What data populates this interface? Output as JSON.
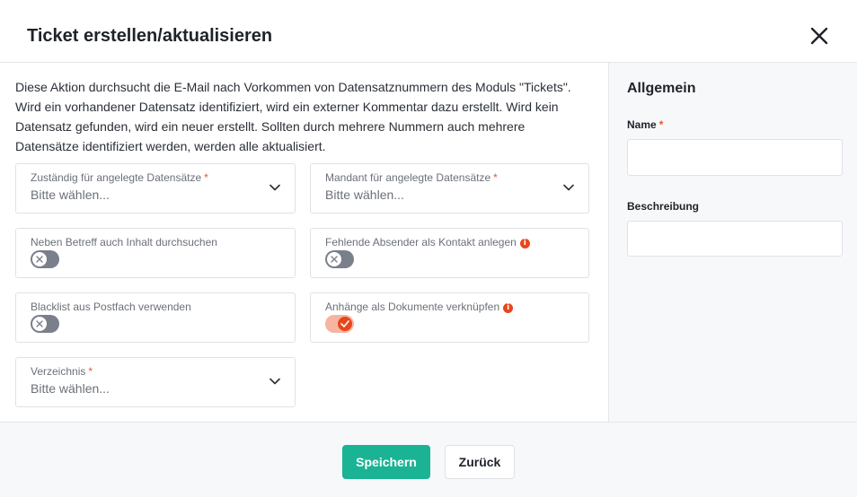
{
  "dialog": {
    "title": "Ticket erstellen/aktualisieren",
    "description": "Diese Aktion durchsucht die E-Mail nach Vorkommen von Datensatznummern des Moduls \"Tickets\". Wird ein vorhandener Datensatz identifiziert, wird ein externer Kommentar dazu erstellt. Wird kein Datensatz gefunden, wird ein neuer erstellt. Sollten durch mehrere Nummern auch mehrere Datensätze identifiziert werden, werden alle aktualisiert."
  },
  "form": {
    "responsible": {
      "label": "Zuständig für angelegte Datensätze",
      "required_mark": "*",
      "value": "Bitte wählen..."
    },
    "tenant": {
      "label": "Mandant für angelegte Datensätze",
      "required_mark": "*",
      "value": "Bitte wählen..."
    },
    "search_content": {
      "label": "Neben Betreff auch Inhalt durchsuchen",
      "checked": false
    },
    "missing_sender": {
      "label": "Fehlende Absender als Kontakt anlegen",
      "info_icon": "i",
      "checked": false
    },
    "blacklist": {
      "label": "Blacklist aus Postfach verwenden",
      "checked": false
    },
    "attachments": {
      "label": "Anhänge als Dokumente verknüpfen",
      "info_icon": "i",
      "checked": true
    },
    "directory": {
      "label": "Verzeichnis",
      "required_mark": "*",
      "value": "Bitte wählen..."
    }
  },
  "sidebar": {
    "title": "Allgemein",
    "name_label": "Name",
    "name_required_mark": "*",
    "name_value": "",
    "description_label": "Beschreibung",
    "description_value": ""
  },
  "footer": {
    "save_label": "Speichern",
    "back_label": "Zurück"
  },
  "colors": {
    "primary": "#1ab394",
    "accent": "#e8461d",
    "required": "#e8542f",
    "toggle_off": "#7a7f8c",
    "toggle_on_track": "#f7b4a1"
  },
  "icons": {
    "close": "close-icon",
    "dropdown": "chevron-down-icon",
    "info": "info-icon",
    "check": "check-icon",
    "x": "x-icon"
  }
}
